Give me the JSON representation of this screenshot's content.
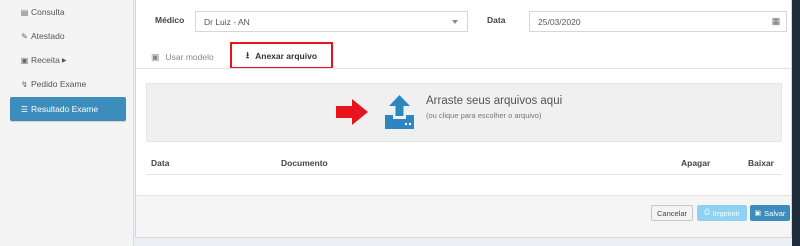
{
  "sidebar": {
    "items": [
      {
        "label": "Consulta",
        "icon": "clipboard-icon"
      },
      {
        "label": "Atestado",
        "icon": "edit-icon"
      },
      {
        "label": "Receita",
        "icon": "briefcase-icon",
        "has_caret": true
      },
      {
        "label": "Pedido Exame",
        "icon": "stethoscope-icon"
      },
      {
        "label": "Resultado Exame",
        "icon": "list-icon",
        "active": true
      }
    ]
  },
  "form": {
    "medico_label": "Médico",
    "medico_value": "Dr Luiz - AN",
    "data_label": "Data",
    "data_value": "25/03/2020"
  },
  "tabs": {
    "usar_modelo": "Usar modelo",
    "anexar_arquivo": "Anexar arquivo"
  },
  "dropzone": {
    "title": "Arraste seus arquivos aqui",
    "subtitle": "(ou clique para escolher o arquivo)"
  },
  "table": {
    "columns": [
      "Data",
      "Documento",
      "Apagar",
      "Baixar"
    ]
  },
  "footer": {
    "cancel": "Cancelar",
    "print": "Imprimir",
    "save": "Salvar"
  },
  "colors": {
    "primary": "#3c8dbc",
    "highlight_border": "#e8131c",
    "arrow": "#e8131c",
    "print_button": "#8fd1f3"
  }
}
